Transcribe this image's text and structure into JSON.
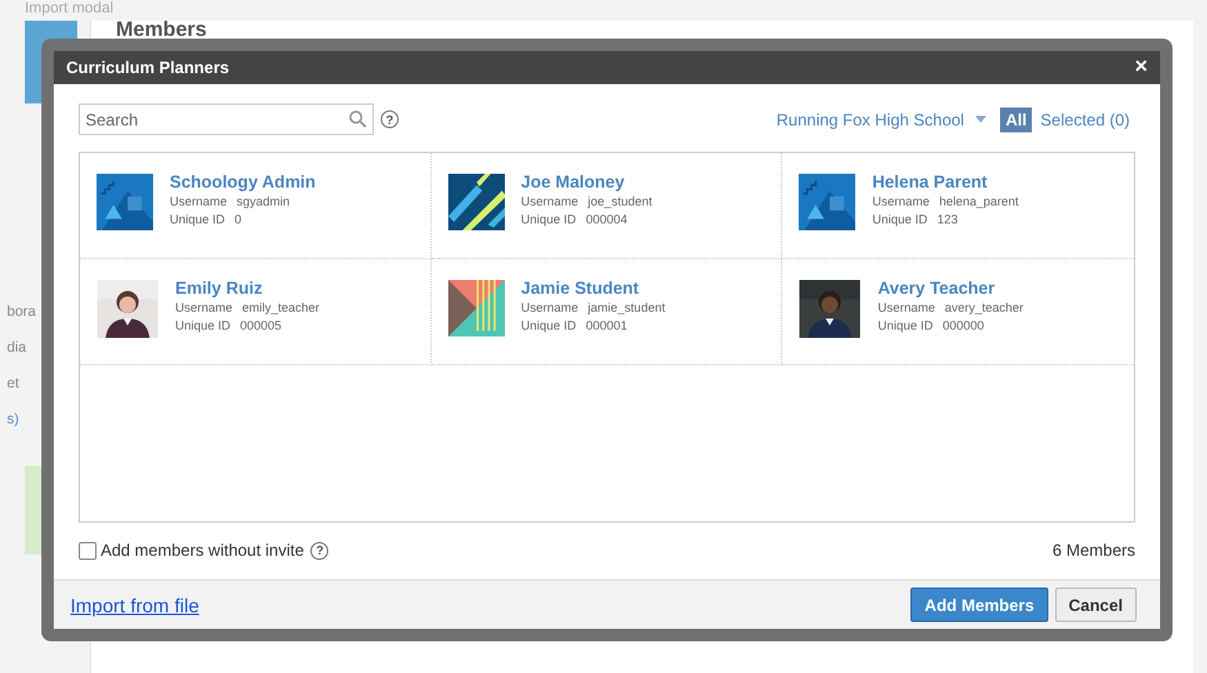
{
  "page": {
    "caption": "Import modal",
    "heading": "Members",
    "side_items": [
      "bora",
      "dia",
      "et",
      "s)"
    ]
  },
  "modal": {
    "title": "Curriculum Planners",
    "close": "×",
    "search": {
      "placeholder": "Search"
    },
    "help": "?",
    "school": "Running Fox High School",
    "filters": [
      {
        "label": "All",
        "selected": true
      },
      {
        "label": "Selected (0)",
        "selected": false
      }
    ],
    "members": [
      {
        "name": "Schoology Admin",
        "username_label": "Username",
        "username": "sgyadmin",
        "id_label": "Unique ID",
        "id": "0",
        "kind": "mountain"
      },
      {
        "name": "Joe Maloney",
        "username_label": "Username",
        "username": "joe_student",
        "id_label": "Unique ID",
        "id": "000004",
        "kind": "stripes"
      },
      {
        "name": "Helena Parent",
        "username_label": "Username",
        "username": "helena_parent",
        "id_label": "Unique ID",
        "id": "123",
        "kind": "mountain"
      },
      {
        "name": "Emily Ruiz",
        "username_label": "Username",
        "username": "emily_teacher",
        "id_label": "Unique ID",
        "id": "000005",
        "kind": "photo-light"
      },
      {
        "name": "Jamie Student",
        "username_label": "Username",
        "username": "jamie_student",
        "id_label": "Unique ID",
        "id": "000001",
        "kind": "triangles"
      },
      {
        "name": "Avery Teacher",
        "username_label": "Username",
        "username": "avery_teacher",
        "id_label": "Unique ID",
        "id": "000000",
        "kind": "photo-dark"
      }
    ],
    "without_invite": {
      "label": "Add members without invite",
      "checked": false
    },
    "count": "6 Members",
    "import_link": "Import from file",
    "buttons": [
      {
        "label": "Add Members",
        "kind": "primary"
      },
      {
        "label": "Cancel",
        "kind": "secondary"
      }
    ]
  }
}
